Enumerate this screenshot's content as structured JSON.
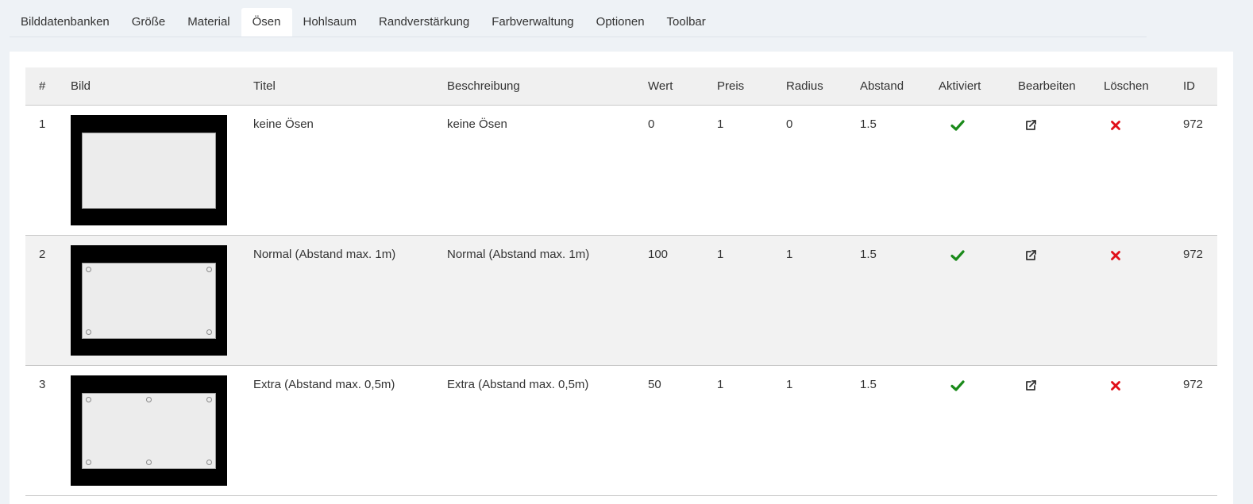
{
  "tabs": [
    {
      "label": "Bilddatenbanken"
    },
    {
      "label": "Größe"
    },
    {
      "label": "Material"
    },
    {
      "label": "Ösen",
      "active": true
    },
    {
      "label": "Hohlsaum"
    },
    {
      "label": "Randverstärkung"
    },
    {
      "label": "Farbverwaltung"
    },
    {
      "label": "Optionen"
    },
    {
      "label": "Toolbar"
    }
  ],
  "table": {
    "headers": [
      "#",
      "Bild",
      "Titel",
      "Beschreibung",
      "Wert",
      "Preis",
      "Radius",
      "Abstand",
      "Aktiviert",
      "Bearbeiten",
      "Löschen",
      "ID"
    ],
    "rows": [
      {
        "num": "1",
        "title": "keine Ösen",
        "description": "keine Ösen",
        "wert": "0",
        "preis": "1",
        "radius": "0",
        "abstand": "1.5",
        "activated": "check-icon",
        "edit": "external-link-icon",
        "delete": "x-icon",
        "id": "972",
        "grommets": "none"
      },
      {
        "num": "2",
        "title": "Normal (Abstand max. 1m)",
        "description": "Normal (Abstand max. 1m)",
        "wert": "100",
        "preis": "1",
        "radius": "1",
        "abstand": "1.5",
        "activated": "check-icon",
        "edit": "external-link-icon",
        "delete": "x-icon",
        "id": "972",
        "grommets": "corners"
      },
      {
        "num": "3",
        "title": "Extra (Abstand max. 0,5m)",
        "description": "Extra (Abstand max. 0,5m)",
        "wert": "50",
        "preis": "1",
        "radius": "1",
        "abstand": "1.5",
        "activated": "check-icon",
        "edit": "external-link-icon",
        "delete": "x-icon",
        "id": "972",
        "grommets": "corners-and-middle"
      }
    ]
  },
  "colors": {
    "check": "#1a8a1a",
    "delete": "#e0101a",
    "edit": "#333333"
  }
}
